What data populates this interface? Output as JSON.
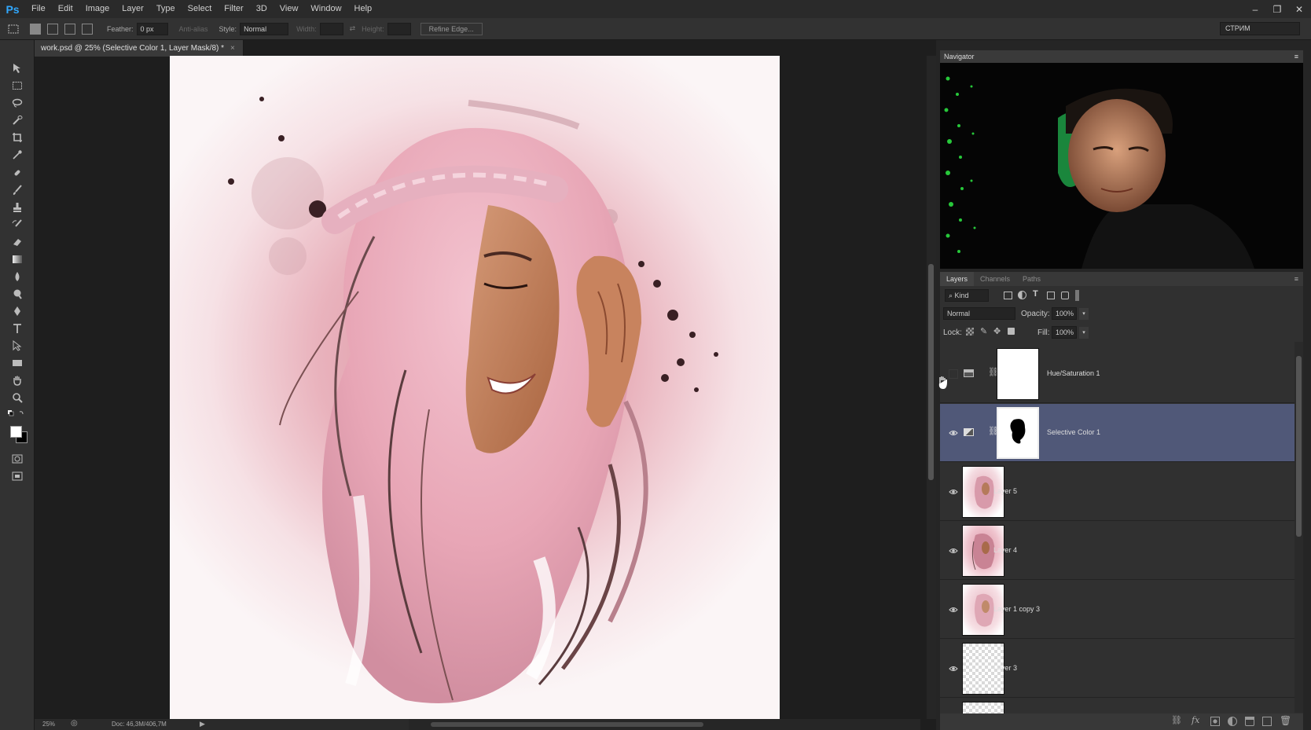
{
  "app": {
    "logo": "Ps"
  },
  "menubar": {
    "items": [
      "File",
      "Edit",
      "Image",
      "Layer",
      "Type",
      "Select",
      "Filter",
      "3D",
      "View",
      "Window",
      "Help"
    ]
  },
  "window_controls": {
    "minimize": "–",
    "restore": "❐",
    "close": "✕"
  },
  "options": {
    "feather_label": "Feather:",
    "feather_value": "0 px",
    "antialias_label": "Anti-alias",
    "style_label": "Style:",
    "style_value": "Normal",
    "width_label": "Width:",
    "height_label": "Height:",
    "refine_edge": "Refine Edge...",
    "workspace": "СТРИМ"
  },
  "document": {
    "tab_title": "work.psd @ 25% (Selective Color 1, Layer Mask/8) *",
    "tab_close": "×",
    "zoom": "25%",
    "doc_size": "Doc: 46,3M/406,7M"
  },
  "navigator": {
    "title": "Navigator"
  },
  "layers_panel": {
    "tabs": [
      "Layers",
      "Channels",
      "Paths"
    ],
    "filter_kind": "Kind",
    "blend_mode": "Normal",
    "opacity_label": "Opacity:",
    "opacity_value": "100%",
    "lock_label": "Lock:",
    "fill_label": "Fill:",
    "fill_value": "100%",
    "layers": [
      {
        "name": "Hue/Saturation 1",
        "visible": false,
        "selected": false,
        "kind": "adjustment"
      },
      {
        "name": "Selective Color 1",
        "visible": true,
        "selected": true,
        "kind": "adjustment"
      },
      {
        "name": "Layer 5",
        "visible": true,
        "selected": false,
        "kind": "pixel"
      },
      {
        "name": "Layer 4",
        "visible": true,
        "selected": false,
        "kind": "pixel"
      },
      {
        "name": "Layer 1 copy 3",
        "visible": true,
        "selected": false,
        "kind": "pixel"
      },
      {
        "name": "Layer 3",
        "visible": true,
        "selected": false,
        "kind": "pixel"
      }
    ]
  },
  "colors": {
    "selection": "#505878",
    "panel": "#303030",
    "accent": "#31a8ff"
  }
}
